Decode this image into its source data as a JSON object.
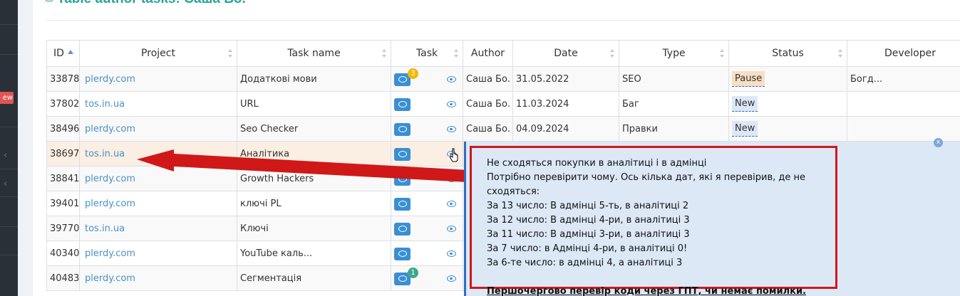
{
  "page": {
    "title": "Table author tasks: Саша Бо."
  },
  "sidebar": {
    "new_badge": "ew",
    "chevron_1": "‹",
    "chevron_2": "‹"
  },
  "table": {
    "columns": [
      "ID",
      "Project",
      "Task name",
      "Task",
      "Author",
      "Date",
      "Type",
      "Status",
      "Developer"
    ],
    "rows": [
      {
        "id": "33878",
        "project": "plerdy.com",
        "task_name": "Додаткові мови",
        "comments": "3",
        "comments_color": "#f5b800",
        "author": "Саша Бо.",
        "date": "31.05.2022",
        "type": "SEO",
        "status": "Pause",
        "developer": "Богд..."
      },
      {
        "id": "37802",
        "project": "tos.in.ua",
        "task_name": "URL",
        "comments": "",
        "author": "Саша Бо.",
        "date": "11.03.2024",
        "type": "Баг",
        "status": "New",
        "developer": ""
      },
      {
        "id": "38496",
        "project": "plerdy.com",
        "task_name": "Seo Checker",
        "comments": "",
        "author": "Саша Бо.",
        "date": "04.09.2024",
        "type": "Правки",
        "status": "New",
        "developer": ""
      },
      {
        "id": "38697",
        "project": "tos.in.ua",
        "task_name": "Аналітика",
        "comments": "",
        "author": "",
        "date": "",
        "type": "",
        "status": "",
        "developer": ""
      },
      {
        "id": "38841",
        "project": "plerdy.com",
        "task_name": "Growth Hackers",
        "comments": "",
        "author": "",
        "date": "",
        "type": "",
        "status": "",
        "developer": ""
      },
      {
        "id": "39401",
        "project": "plerdy.com",
        "task_name": "ключі PL",
        "comments": "",
        "author": "",
        "date": "",
        "type": "",
        "status": "",
        "developer": ""
      },
      {
        "id": "39770",
        "project": "tos.in.ua",
        "task_name": "Ключі",
        "comments": "",
        "author": "",
        "date": "",
        "type": "",
        "status": "",
        "developer": ""
      },
      {
        "id": "40340",
        "project": "plerdy.com",
        "task_name": "YouTube каль...",
        "comments": "",
        "author": "",
        "date": "",
        "type": "",
        "status": "",
        "developer": ""
      },
      {
        "id": "40483",
        "project": "plerdy.com",
        "task_name": "Сегментація",
        "comments": "1",
        "comments_color": "#3aa88e",
        "author": "",
        "date": "",
        "type": "",
        "status": "",
        "developer": ""
      }
    ]
  },
  "popup": {
    "close": "x",
    "lines": [
      "Не сходяться покупки в аналітиці і в адмінці",
      "Потрібно перевірити чому. Ось кілька дат, які я перевірив, де не сходяться:",
      "За 13 число: В адмінці 5-ть, в аналітиці 2",
      "За 12 число: В адмінці 4-ри, в аналітиці 3",
      "За 11 число: В адмінці 3-ри, в аналітиці 3",
      "За 7 число: в Адмінці 4-ри, в аналітиці 0!",
      "За 6-те число: в адмінці 4, а аналітиці 3"
    ],
    "emphasis": "Першочергово перевір коди через ГПТ, чи немає помилки."
  },
  "colors": {
    "accent": "#26a69a",
    "link": "#4a90c8",
    "chat_button": "#3a8fd4",
    "annotation_red": "#d01818",
    "popup_bg": "#dce8f6"
  }
}
